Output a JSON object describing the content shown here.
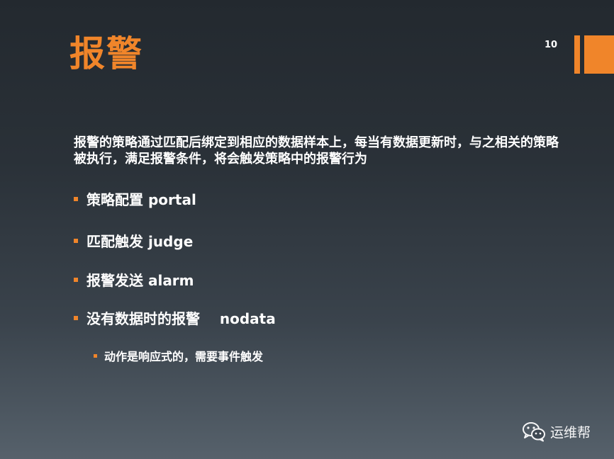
{
  "slide": {
    "title": "报警",
    "page_number": "10",
    "intro": "报警的策略通过匹配后绑定到相应的数据样本上，每当有数据更新时，与之相关的策略被执行，满足报警条件，将会触发策略中的报警行为",
    "bullets": [
      "策略配置 portal",
      "匹配触发 judge",
      "报警发送 alarm",
      "没有数据时的报警    nodata"
    ],
    "sub_bullet": "动作是响应式的，需要事件触发"
  },
  "watermark": {
    "icon": "wechat-icon",
    "label": "运维帮"
  },
  "colors": {
    "accent": "#f0852a",
    "background_top": "#23292f",
    "background_bottom": "#56616b",
    "text": "#ffffff"
  }
}
